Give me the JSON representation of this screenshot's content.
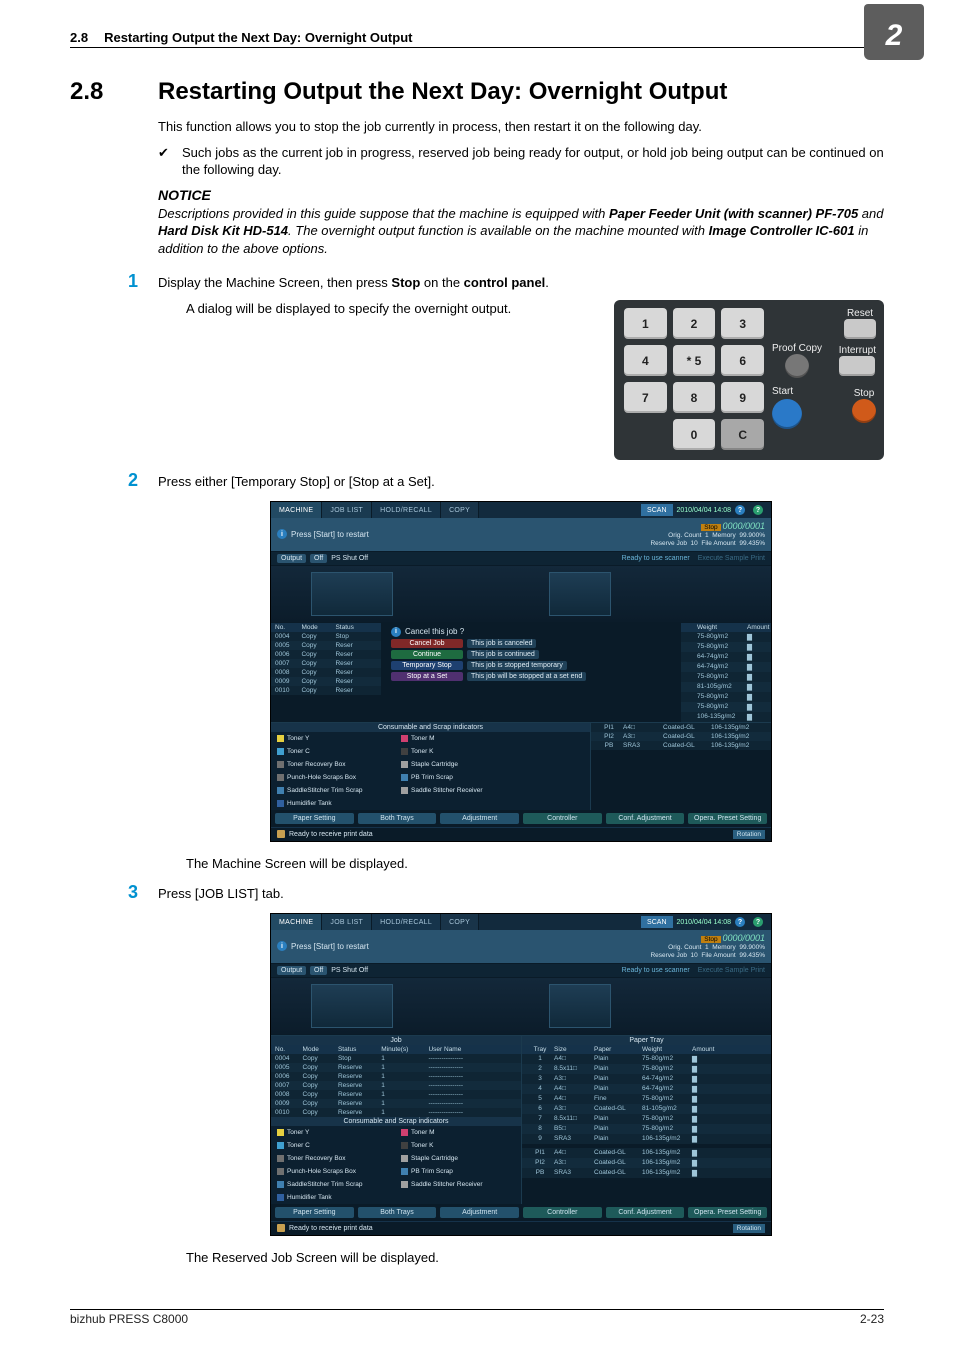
{
  "page": {
    "header_section_num": "2.8",
    "header_title": "Restarting Output the Next Day: Overnight Output",
    "chapter_badge": "2",
    "footer_left": "bizhub PRESS C8000",
    "footer_right": "2-23"
  },
  "heading": {
    "num": "2.8",
    "text": "Restarting Output the Next Day: Overnight Output"
  },
  "intro_para": "This function allows you to stop the job currently in process, then restart it on the following day.",
  "checkmark": "✔",
  "check_text": "Such jobs as the current job in progress, reserved job being ready for output, or hold job being output can be continued on the following day.",
  "notice": {
    "title": "NOTICE",
    "body_before": "Descriptions provided in this guide suppose that the machine is equipped with ",
    "body_bold1": "Paper Feeder Unit (with scanner) PF-705",
    "body_mid1": " and ",
    "body_bold2": "Hard Disk Kit HD-514",
    "body_mid2": ". The overnight output function is available on the machine mounted with ",
    "body_bold3": "Image Controller IC-601",
    "body_after": " in addition to the above options."
  },
  "steps": {
    "s1_num": "1",
    "s1_text_before": "Display the Machine Screen, then press ",
    "s1_bold_stop": "Stop",
    "s1_text_mid": " on the ",
    "s1_bold_panel": "control panel",
    "s1_text_after": ".",
    "s1_sub": "A dialog will be displayed to specify the overnight output.",
    "s2_num": "2",
    "s2_text": "Press either [Temporary Stop] or [Stop at a Set].",
    "s2_result": "The Machine Screen will be displayed.",
    "s3_num": "3",
    "s3_text": "Press [JOB LIST] tab.",
    "s3_result": "The Reserved Job Screen will be displayed."
  },
  "control_panel": {
    "keys": [
      "1",
      "2",
      "3",
      "4",
      "* 5",
      "6",
      "7",
      "8",
      "9",
      "",
      "0",
      "C"
    ],
    "label_reset": "Reset",
    "label_interrupt": "Interrupt",
    "label_proof": "Proof Copy",
    "label_stop": "Stop",
    "label_start": "Start"
  },
  "ms_common": {
    "tab_machine": "MACHINE",
    "tab_joblist": "JOB LIST",
    "tab_recall": "HOLD/RECALL",
    "tab_copy": "COPY",
    "tab_scan": "SCAN",
    "clock": "2010/04/04 14:08",
    "banner_msg": "Press [Start] to restart",
    "stop_label": "Stop",
    "counter": "0000/0001",
    "orig_count_label": "Orig. Count",
    "orig_count_val": "1",
    "memory_label": "Memory",
    "memory_val": "99.900%",
    "reserve_label": "Reserve Job",
    "reserve_val": "10",
    "file_amount_label": "File Amount",
    "file_amount_val": "99.435%",
    "ps_shut_off": "PS Shut Off",
    "ready_scanner": "Ready to use scanner",
    "exec_sample": "Execute Sample Print",
    "footer_msg": "Ready to receive print data",
    "footer_rotation": "Rotation",
    "bb_paper_setting": "Paper Setting",
    "bb_both_trays": "Both Trays",
    "bb_adjustment": "Adjustment",
    "bb_controller": "Controller",
    "bb_conf_adjust": "Conf. Adjustment",
    "bb_oper_preset": "Opera. Preset Setting",
    "cons_sect": "Consumable and Scrap indicators",
    "cons": [
      {
        "label": "Toner Y",
        "color": "#e6d040"
      },
      {
        "label": "Toner M",
        "color": "#d04070"
      },
      {
        "label": "Toner C",
        "color": "#40a0d0"
      },
      {
        "label": "Toner K",
        "color": "#404040"
      },
      {
        "label": "Toner Recovery Box",
        "color": "#707070"
      },
      {
        "label": "Staple Cartridge",
        "color": "#a0a0a0"
      },
      {
        "label": "Punch-Hole Scraps Box",
        "color": "#707070"
      },
      {
        "label": "PB Trim Scrap",
        "color": "#4080b0"
      },
      {
        "label": "SaddleStitcher Trim Scrap",
        "color": "#4080b0"
      },
      {
        "label": "Saddle Stitcher Receiver",
        "color": "#a0a0a0"
      },
      {
        "label": "Humidifier Tank",
        "color": "#3060a0"
      }
    ]
  },
  "ms_dialog": {
    "title": "Cancel this job ?",
    "options": [
      {
        "btn": "Cancel Job",
        "desc": "This job is canceled",
        "color": "#802828"
      },
      {
        "btn": "Continue",
        "desc": "This job is continued",
        "color": "#1e6b40"
      },
      {
        "btn": "Temporary Stop",
        "desc": "This job is stopped temporary",
        "color": "#1e4070"
      },
      {
        "btn": "Stop at a Set",
        "desc": "This job will be stopped at a set end",
        "color": "#503070"
      }
    ]
  },
  "ms_job_header": {
    "no": "No.",
    "mode": "Mode",
    "status": "Status",
    "min": "Minute(s)",
    "user": "User Name",
    "section_job": "Job",
    "section_tray": "Paper Tray",
    "tray": "Tray",
    "size": "Size",
    "paper": "Paper",
    "weight": "Weight",
    "amount": "Amount"
  },
  "ms_jobs": [
    {
      "no": "0004",
      "mode": "Copy",
      "status": "Stop",
      "min": "1",
      "user": "----------------"
    },
    {
      "no": "0005",
      "mode": "Copy",
      "status": "Reserve",
      "min": "1",
      "user": "----------------"
    },
    {
      "no": "0006",
      "mode": "Copy",
      "status": "Reserve",
      "min": "1",
      "user": "----------------"
    },
    {
      "no": "0007",
      "mode": "Copy",
      "status": "Reserve",
      "min": "1",
      "user": "----------------"
    },
    {
      "no": "0008",
      "mode": "Copy",
      "status": "Reserve",
      "min": "1",
      "user": "----------------"
    },
    {
      "no": "0009",
      "mode": "Copy",
      "status": "Reserve",
      "min": "1",
      "user": "----------------"
    },
    {
      "no": "0010",
      "mode": "Copy",
      "status": "Reserve",
      "min": "1",
      "user": "----------------"
    }
  ],
  "ms_trays_right_partial": [
    {
      "weight": "75-80g/m2"
    },
    {
      "weight": "75-80g/m2"
    },
    {
      "weight": "64-74g/m2"
    },
    {
      "weight": "64-74g/m2"
    },
    {
      "weight": "75-80g/m2"
    },
    {
      "weight": "81-105g/m2"
    },
    {
      "weight": "75-80g/m2"
    },
    {
      "weight": "75-80g/m2"
    },
    {
      "weight": "106-135g/m2"
    }
  ],
  "ms_trays_full": [
    {
      "tray": "1",
      "size": "A4□",
      "paper": "Plain",
      "weight": "75-80g/m2"
    },
    {
      "tray": "2",
      "size": "8.5x11□",
      "paper": "Plain",
      "weight": "75-80g/m2"
    },
    {
      "tray": "3",
      "size": "A3□",
      "paper": "Plain",
      "weight": "64-74g/m2"
    },
    {
      "tray": "4",
      "size": "A4□",
      "paper": "Plain",
      "weight": "64-74g/m2"
    },
    {
      "tray": "5",
      "size": "A4□",
      "paper": "Fine",
      "weight": "75-80g/m2"
    },
    {
      "tray": "6",
      "size": "A3□",
      "paper": "Coated-GL",
      "weight": "81-105g/m2"
    },
    {
      "tray": "7",
      "size": "8.5x11□",
      "paper": "Plain",
      "weight": "75-80g/m2"
    },
    {
      "tray": "8",
      "size": "B5□",
      "paper": "Plain",
      "weight": "75-80g/m2"
    },
    {
      "tray": "9",
      "size": "SRA3",
      "paper": "Plain",
      "weight": "106-135g/m2"
    }
  ],
  "ms_pi_trays": [
    {
      "tray": "PI1",
      "size": "A4□",
      "paper": "Coated-GL",
      "weight": "106-135g/m2"
    },
    {
      "tray": "PI2",
      "size": "A3□",
      "paper": "Coated-GL",
      "weight": "106-135g/m2"
    },
    {
      "tray": "PB",
      "size": "SRA3",
      "paper": "Coated-GL",
      "weight": "106-135g/m2"
    }
  ]
}
